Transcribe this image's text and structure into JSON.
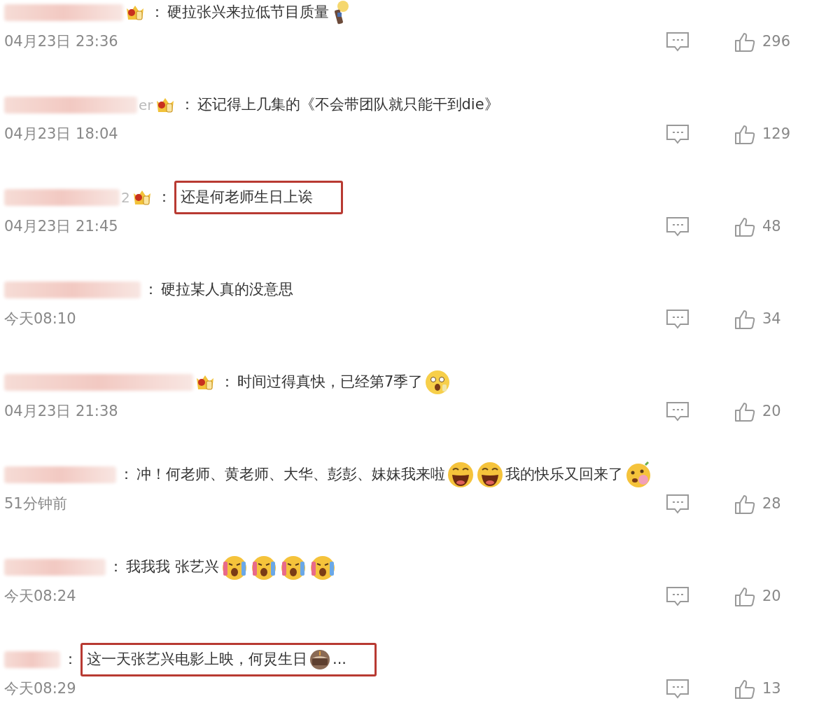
{
  "comments": [
    {
      "badge": true,
      "separator": "：",
      "highlighted": false,
      "content": [
        {
          "kind": "text",
          "text": "硬拉张兴来拉低节目质量"
        },
        {
          "kind": "torch"
        }
      ],
      "time": "04月23日 23:36",
      "likes": "296"
    },
    {
      "name_tail": "er",
      "badge": true,
      "separator": "：",
      "highlighted": false,
      "content": [
        {
          "kind": "text",
          "text": "还记得上几集的《不会带团队就只能干到die》"
        }
      ],
      "time": "04月23日 18:04",
      "likes": "129"
    },
    {
      "name_tail": "2",
      "badge": true,
      "separator": "：",
      "highlighted": true,
      "content": [
        {
          "kind": "text",
          "text": "还是何老师生日上诶"
        }
      ],
      "time": "04月23日 21:45",
      "likes": "48"
    },
    {
      "badge": false,
      "separator": "：",
      "highlighted": false,
      "content": [
        {
          "kind": "text",
          "text": "硬拉某人真的没意思"
        }
      ],
      "time": "今天08:10",
      "likes": "34"
    },
    {
      "badge": true,
      "separator": "：",
      "highlighted": false,
      "content": [
        {
          "kind": "text",
          "text": "时间过得真快，已经第7季了"
        },
        {
          "kind": "shocked"
        }
      ],
      "time": "04月23日 21:38",
      "likes": "20"
    },
    {
      "badge": false,
      "separator": "：",
      "highlighted": false,
      "content": [
        {
          "kind": "text",
          "text": "冲！何老师、黄老师、大华、彭彭、妹妹我来啦"
        },
        {
          "kind": "laughing"
        },
        {
          "kind": "laughing"
        },
        {
          "kind": "text",
          "text": "我的快乐又回来了"
        },
        {
          "kind": "blushing"
        }
      ],
      "time": "51分钟前",
      "likes": "28"
    },
    {
      "badge": false,
      "separator": "：",
      "highlighted": false,
      "content": [
        {
          "kind": "text",
          "text": "我我我 张艺兴"
        },
        {
          "kind": "crying"
        },
        {
          "kind": "crying"
        },
        {
          "kind": "crying"
        },
        {
          "kind": "crying"
        }
      ],
      "time": "今天08:24",
      "likes": "20"
    },
    {
      "badge": false,
      "separator": "：",
      "highlighted": true,
      "content": [
        {
          "kind": "text",
          "text": "这一天张艺兴电影上映，何炅生日"
        },
        {
          "kind": "cake"
        },
        {
          "kind": "text",
          "text": "..."
        }
      ],
      "time": "今天08:29",
      "likes": "13"
    }
  ]
}
